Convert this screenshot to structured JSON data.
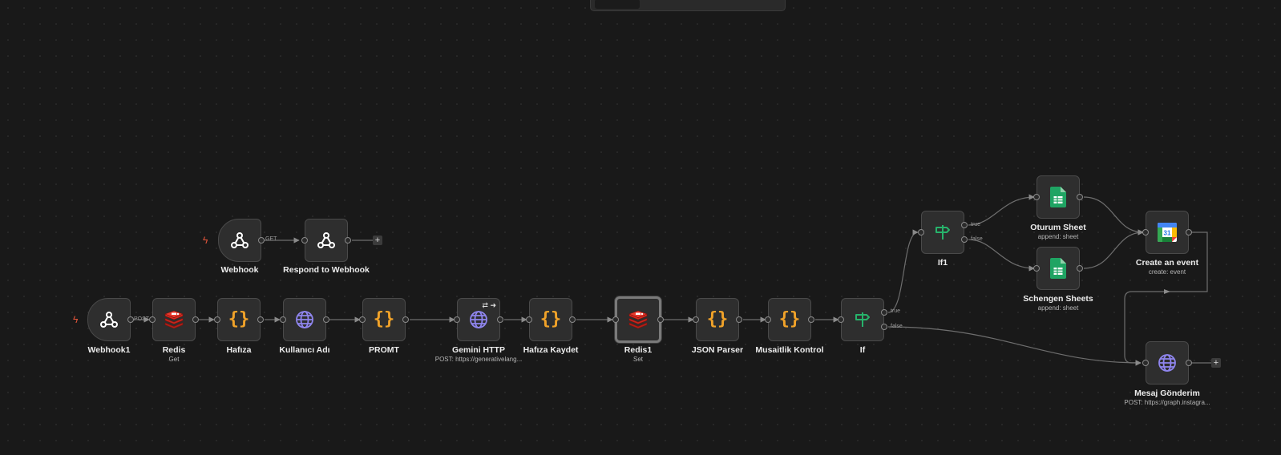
{
  "toolbar": {
    "tabs": []
  },
  "nodes": {
    "webhook": {
      "label": "Webhook"
    },
    "respond": {
      "label": "Respond to Webhook"
    },
    "webhook1": {
      "label": "Webhook1"
    },
    "redis": {
      "label": "Redis",
      "subtitle": "Get"
    },
    "hafiza": {
      "label": "Hafıza"
    },
    "kullanici": {
      "label": "Kullanıcı Adı"
    },
    "promt": {
      "label": "PROMT"
    },
    "gemini": {
      "label": "Gemini HTTP",
      "subtitle": "POST: https://generativelang..."
    },
    "hafiza_kaydet": {
      "label": "Hafıza Kaydet"
    },
    "redis1": {
      "label": "Redis1",
      "subtitle": "Set"
    },
    "json_parser": {
      "label": "JSON Parser"
    },
    "musaitlik": {
      "label": "Musaitlik Kontrol"
    },
    "if": {
      "label": "If"
    },
    "if1": {
      "label": "If1"
    },
    "oturum": {
      "label": "Oturum Sheet",
      "subtitle": "append: sheet"
    },
    "schengen": {
      "label": "Schengen Sheets",
      "subtitle": "append: sheet"
    },
    "create_event": {
      "label": "Create an event",
      "subtitle": "create: event"
    },
    "mesaj": {
      "label": "Mesaj Gönderim",
      "subtitle": "POST: https://graph.instagra..."
    }
  },
  "edge_labels": {
    "get": "GET",
    "post": "POST",
    "if_true": "true",
    "if_false": "false",
    "if1_true": "true",
    "if1_false": "false"
  },
  "icons": {
    "webhook": "webhook-icon",
    "redis": "redis-icon",
    "code": "curly-braces-icon",
    "http": "globe-icon",
    "if": "signpost-icon",
    "sheets": "google-sheets-icon",
    "calendar": "google-calendar-icon",
    "trigger": "lightning-bolt-icon",
    "add": "plus-icon"
  },
  "colors": {
    "canvas": "#191919",
    "node_bg": "#2e2e2e",
    "code_orange": "#f0a229",
    "globe_purple": "#8f85ee",
    "if_green": "#27b36b",
    "redis_red": "#d0261d",
    "sheets_green": "#1fa463",
    "trigger_red": "#e5553b"
  },
  "add_button": "+"
}
